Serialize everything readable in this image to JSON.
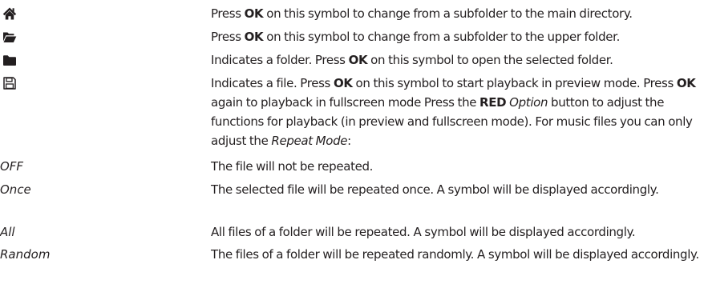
{
  "symbols": [
    {
      "icon": "home-icon",
      "text_before": "Press ",
      "key": "OK",
      "text_after": " on this symbol to change from a subfolder to the main directory."
    },
    {
      "icon": "folder-open-icon",
      "text_before": "Press ",
      "key": "OK",
      "text_after": " on this symbol to change from a subfolder to the upper folder."
    },
    {
      "icon": "folder-icon",
      "text_before": "Indicates a folder. Press ",
      "key": "OK",
      "text_after": " on this symbol to open the selected folder."
    }
  ],
  "file_entry": {
    "icon": "save-file-icon",
    "part1": " Indicates a file. Press ",
    "key1": "OK",
    "part2": " on this symbol to start playback in preview mode. Press ",
    "key2": "OK",
    "part3": " again to playback in fullscreen mode  Press the ",
    "key3": "RED",
    "part4": " ",
    "option_label": "Option",
    "part5": " button to adjust the functions for playback (in preview and fullscreen mode). For music files you can only adjust the ",
    "repeat_label": "Repeat Mode",
    "part6": ":"
  },
  "repeat_modes": [
    {
      "term": "OFF",
      "description": "The file will not be repeated."
    },
    {
      "term": "Once",
      "description": "The selected file will be repeated once. A symbol will be displayed accordingly."
    },
    {
      "term": "All",
      "description": "All files of a folder will be repeated. A symbol will be displayed accordingly."
    },
    {
      "term": "Random",
      "description": "The files of a folder will be repeated randomly. A symbol will be displayed accordingly."
    }
  ]
}
